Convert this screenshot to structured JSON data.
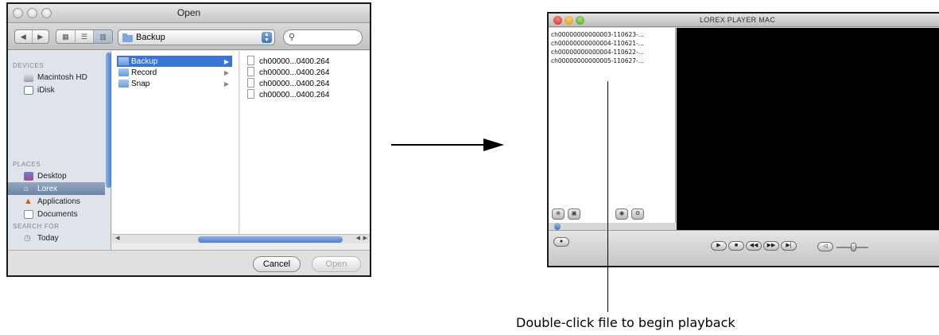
{
  "open_dialog": {
    "title": "Open",
    "location": "Backup",
    "search_placeholder": "",
    "sidebar": {
      "devices_header": "DEVICES",
      "devices": [
        "Macintosh HD",
        "iDisk"
      ],
      "places_header": "PLACES",
      "places": [
        "Desktop",
        "Lorex",
        "Applications",
        "Documents"
      ],
      "selected_place": "Lorex",
      "search_header": "SEARCH FOR",
      "search_items": [
        "Today"
      ]
    },
    "column1": [
      "Backup",
      "Record",
      "Snap"
    ],
    "column1_selected": "Backup",
    "column2": [
      "ch00000...0400.264",
      "ch00000...0400.264",
      "ch00000...0400.264",
      "ch00000...0400.264"
    ],
    "cancel_label": "Cancel",
    "open_label": "Open"
  },
  "player": {
    "title": "LOREX PLAYER MAC",
    "files": [
      "ch00000000000003-110623-...",
      "ch00000000000004-110621-...",
      "ch00000000000004-110622-...",
      "ch00000000000005-110627-..."
    ]
  },
  "callout": "Double-click file to begin playback"
}
